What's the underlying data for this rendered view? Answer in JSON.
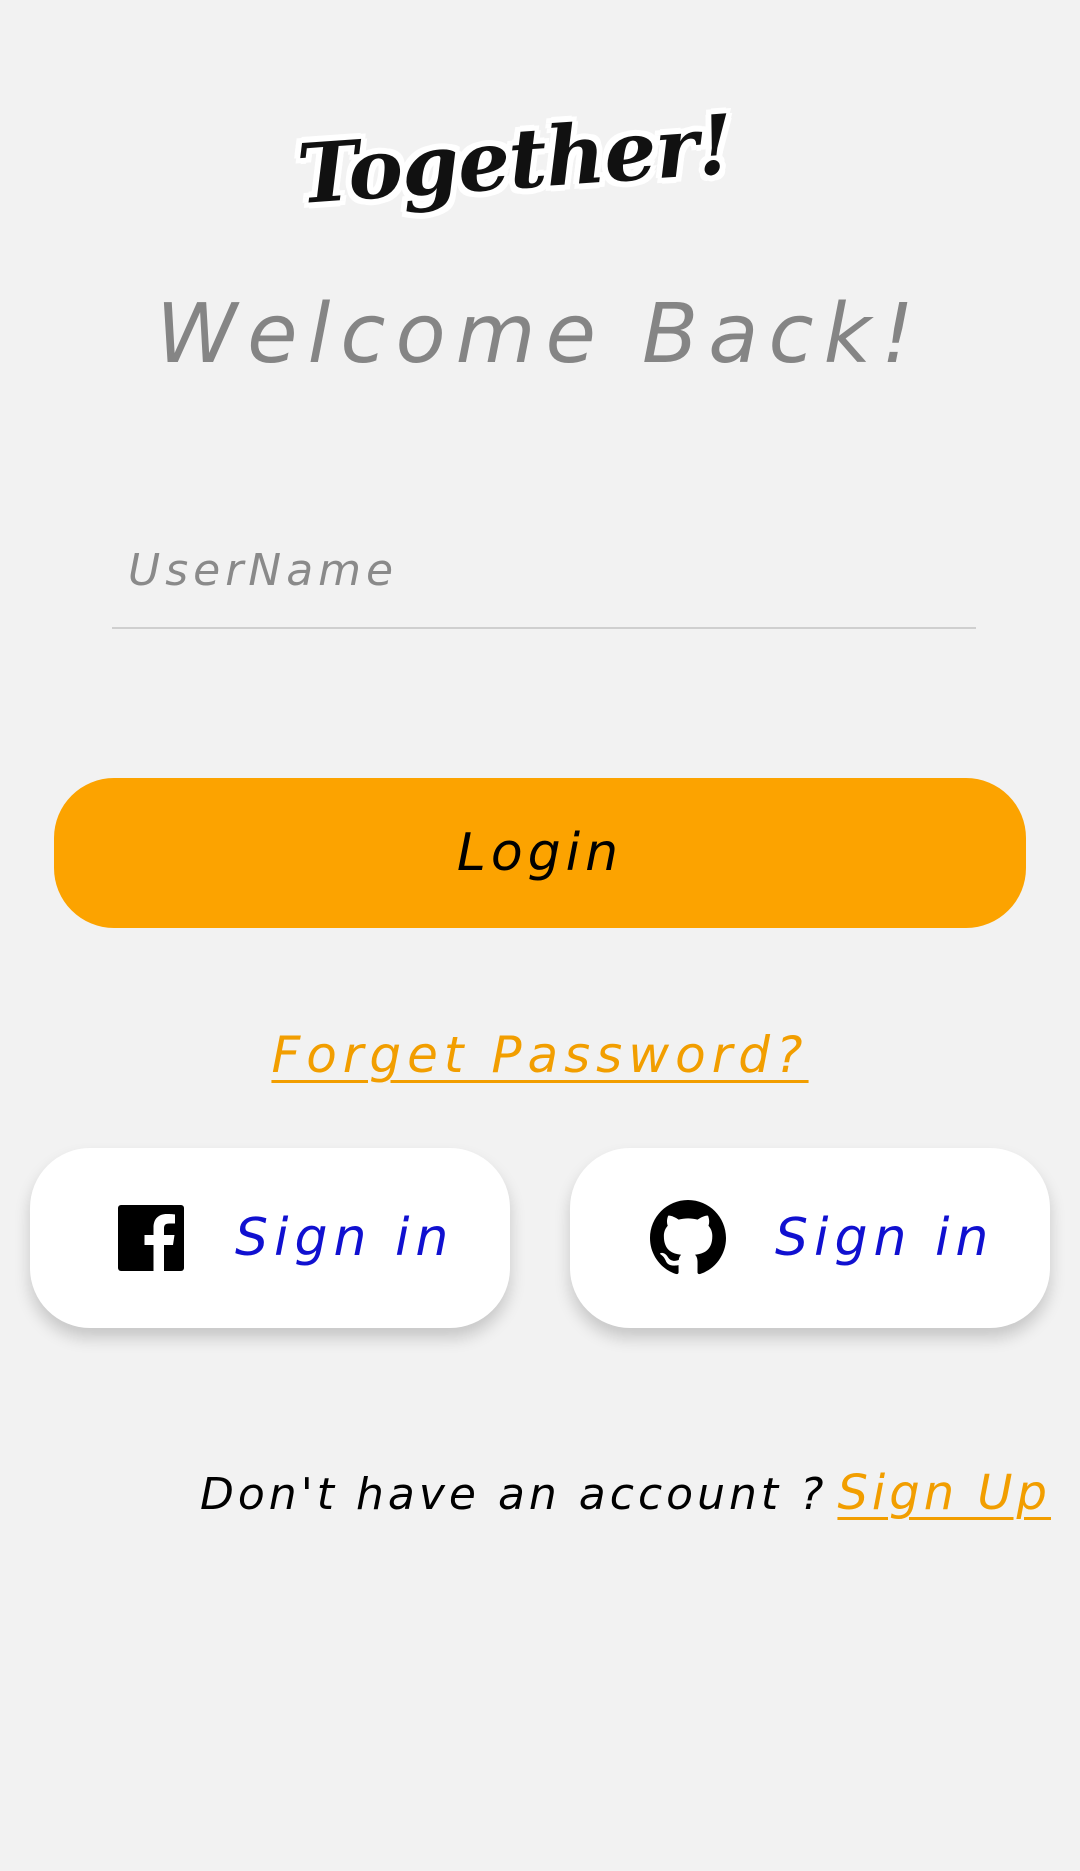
{
  "app": {
    "logo_text": "Together!"
  },
  "header": {
    "welcome": "Welcome Back!"
  },
  "form": {
    "username_placeholder": "UserName",
    "username_value": "",
    "login_label": "Login",
    "forget_label": "Forget Password?"
  },
  "social": {
    "facebook": {
      "icon": "facebook-icon",
      "label": "Sign in"
    },
    "github": {
      "icon": "github-icon",
      "label": "Sign in"
    }
  },
  "footer": {
    "prompt": "Don't have an account ?",
    "signup_label": "Sign Up"
  },
  "colors": {
    "background": "#f2f2f2",
    "accent": "#fca300",
    "link": "#f29e00",
    "social_text": "#1010d0"
  }
}
